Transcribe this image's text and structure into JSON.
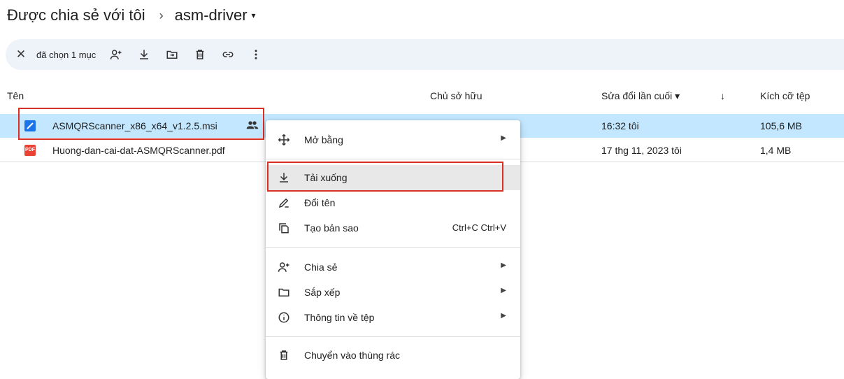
{
  "breadcrumb": {
    "parent": "Được chia sẻ với tôi",
    "separator": "›",
    "current": "asm-driver",
    "caret": "▾"
  },
  "toolbar": {
    "selection_count": "đã chọn 1 mục",
    "close_glyph": "✕"
  },
  "columns": {
    "name": "Tên",
    "owner": "Chủ sở hữu",
    "modified": "Sửa đổi lần cuối ▾",
    "sort_arrow": "↓",
    "size": "Kích cỡ tệp"
  },
  "files": [
    {
      "name": "ASMQRScanner_x86_x64_v1.2.5.msi",
      "modified": "16:32 tôi",
      "size": "105,6 MB",
      "icon": "msi-file-icon",
      "color": "#1a73e8",
      "shared": true
    },
    {
      "name": "Huong-dan-cai-dat-ASMQRScanner.pdf",
      "modified": "17 thg 11, 2023 tôi",
      "size": "1,4 MB",
      "icon": "pdf-file-icon",
      "color": "#ea4335",
      "pdf_badge": "PDF"
    }
  ],
  "context_menu": {
    "open_with": "Mở bằng",
    "download": "Tải xuống",
    "rename": "Đổi tên",
    "copy": "Tạo bản sao",
    "copy_shortcut": "Ctrl+C Ctrl+V",
    "share": "Chia sẻ",
    "organize": "Sắp xếp",
    "file_info": "Thông tin về tệp",
    "trash": "Chuyển vào thùng rác",
    "submenu_arrow": "▶"
  },
  "colors": {
    "selected_row": "#c2e7ff",
    "highlight_box": "#d93025",
    "toolbar_bg": "#eef2f9"
  }
}
